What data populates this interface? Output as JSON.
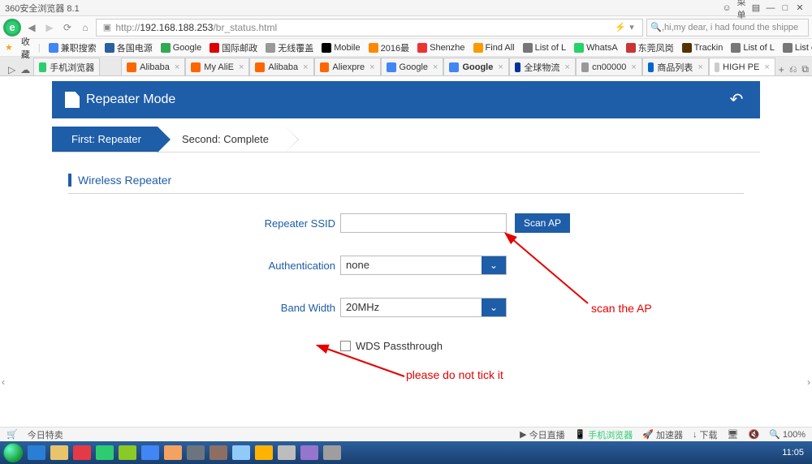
{
  "browser": {
    "title": "360安全浏览器 8.1",
    "url_prefix": "http://",
    "url_host": "192.168.188.253",
    "url_path": "/br_status.html",
    "search_placeholder": ",hi,my dear, i had found the shippe",
    "menu_label": "菜单",
    "fav_label": "收藏"
  },
  "bookmarks": [
    {
      "label": "兼职搜索"
    },
    {
      "label": "各国电源"
    },
    {
      "label": "Google"
    },
    {
      "label": "国际邮政"
    },
    {
      "label": "无线覆盖"
    },
    {
      "label": "Mobile"
    },
    {
      "label": "2016最"
    },
    {
      "label": "Shenzhe"
    },
    {
      "label": "Find All"
    },
    {
      "label": "List of L"
    },
    {
      "label": "WhatsA"
    },
    {
      "label": "东莞凤岗"
    },
    {
      "label": "Trackin"
    },
    {
      "label": "List of L"
    },
    {
      "label": "List of L"
    }
  ],
  "tabs": [
    {
      "label": "手机浏览器",
      "active": false
    },
    {
      "label": "Alibaba",
      "active": false
    },
    {
      "label": "My AliE",
      "active": false
    },
    {
      "label": "Alibaba",
      "active": false
    },
    {
      "label": "Aliexpre",
      "active": false
    },
    {
      "label": "Google",
      "active": false
    },
    {
      "label": "Google",
      "active": false
    },
    {
      "label": "全球物流",
      "active": false
    },
    {
      "label": "cn00000",
      "active": false
    },
    {
      "label": "商品列表",
      "active": false
    },
    {
      "label": "HIGH PE",
      "active": true
    }
  ],
  "router": {
    "title": "Repeater Mode",
    "steps": {
      "first": "First: Repeater",
      "second": "Second: Complete"
    },
    "section": "Wireless Repeater",
    "form": {
      "ssid_label": "Repeater SSID",
      "ssid_value": "",
      "scan_btn": "Scan AP",
      "auth_label": "Authentication",
      "auth_value": "none",
      "bw_label": "Band Width",
      "bw_value": "20MHz",
      "wds_label": "WDS Passthrough",
      "wds_checked": false
    }
  },
  "annotations": {
    "scan": "scan the AP",
    "wds": "please do not tick it"
  },
  "statusbar": {
    "today": "今日特卖",
    "live": "今日直播",
    "mob": "手机浏览器",
    "acc": "加速器",
    "dl": "下载",
    "zoom": "100%"
  },
  "clock": "11:05"
}
